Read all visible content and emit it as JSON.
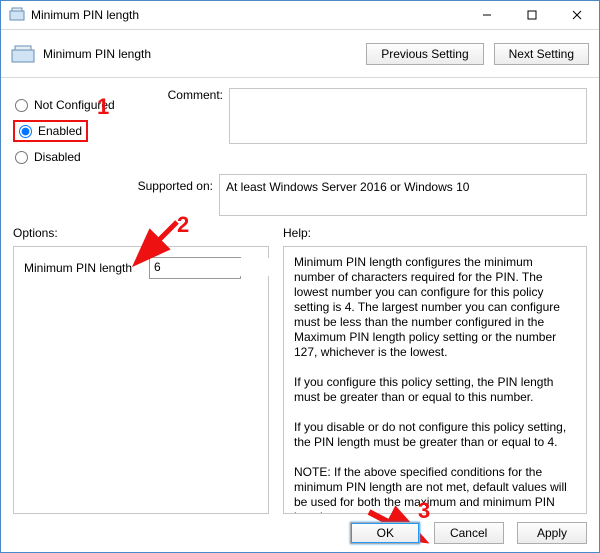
{
  "window": {
    "title": "Minimum PIN length",
    "header_title": "Minimum PIN length",
    "buttons": {
      "prev": "Previous Setting",
      "next": "Next Setting"
    }
  },
  "state": {
    "not_configured": "Not Configured",
    "enabled": "Enabled",
    "disabled": "Disabled",
    "selected": "enabled"
  },
  "comment": {
    "label": "Comment:",
    "value": ""
  },
  "supported": {
    "label": "Supported on:",
    "value": "At least Windows Server 2016 or Windows 10"
  },
  "options": {
    "section_label": "Options:",
    "min_pin_label": "Minimum PIN length",
    "min_pin_value": "6"
  },
  "help": {
    "section_label": "Help:",
    "p1": "Minimum PIN length configures the minimum number of characters required for the PIN.  The lowest number you can configure for this policy setting is 4.  The largest number you can configure must be less than the number configured in the Maximum PIN length policy setting or the number 127, whichever is the lowest.",
    "p2": "If you configure this policy setting, the PIN length must be greater than or equal to this number.",
    "p3": "If you disable or do not configure this policy setting, the PIN length must be greater than or equal to 4.",
    "p4": "NOTE: If the above specified conditions for the minimum PIN length are not met, default values will be used for both the maximum and minimum PIN lengths."
  },
  "footer": {
    "ok": "OK",
    "cancel": "Cancel",
    "apply": "Apply"
  },
  "annotations": {
    "n1": "1",
    "n2": "2",
    "n3": "3"
  }
}
